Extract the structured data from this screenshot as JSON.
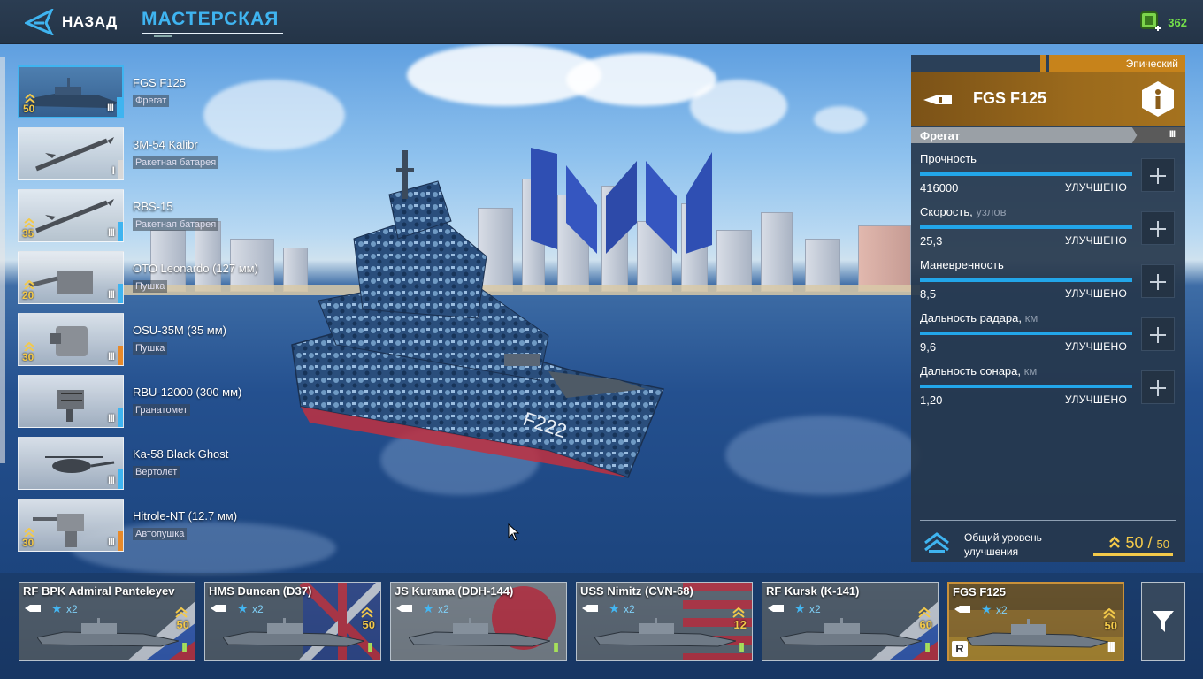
{
  "topbar": {
    "back_label": "НАЗАД",
    "tab_title": "МАСТЕРСКАЯ",
    "currency_value": "362",
    "accent_color": "#3fb4f0"
  },
  "equipment": [
    {
      "name": "FGS F125",
      "type": "Фрегат",
      "level": "50",
      "tier": "III",
      "active": true,
      "icon": "frigate-thumb-icon",
      "rank_color": "#3fb4f0"
    },
    {
      "name": "3M-54 Kalibr",
      "type": "Ракетная батарея",
      "level": "",
      "tier": "I",
      "active": false,
      "icon": "missile-icon",
      "rank_color": "#d8d8d8"
    },
    {
      "name": "RBS-15",
      "type": "Ракетная батарея",
      "level": "35",
      "tier": "III",
      "active": false,
      "icon": "missile-icon",
      "rank_color": "#3fb4f0"
    },
    {
      "name": "OTO Leonardo (127 мм)",
      "type": "Пушка",
      "level": "20",
      "tier": "III",
      "active": false,
      "icon": "cannon-icon",
      "rank_color": "#3fb4f0"
    },
    {
      "name": "OSU-35M (35 мм)",
      "type": "Пушка",
      "level": "30",
      "tier": "III",
      "active": false,
      "icon": "turret-icon",
      "rank_color": "#e88a2a"
    },
    {
      "name": "RBU-12000 (300 мм)",
      "type": "Гранатомет",
      "level": "",
      "tier": "III",
      "active": false,
      "icon": "rocket-launcher-icon",
      "rank_color": "#3fb4f0"
    },
    {
      "name": "Ka-58 Black Ghost",
      "type": "Вертолет",
      "level": "",
      "tier": "III",
      "active": false,
      "icon": "helicopter-icon",
      "rank_color": "#3fb4f0"
    },
    {
      "name": "Hitrole-NT (12.7 мм)",
      "type": "Автопушка",
      "level": "30",
      "tier": "III",
      "active": false,
      "icon": "autocannon-icon",
      "rank_color": "#e88a2a"
    }
  ],
  "panel": {
    "rarity": "Эпический",
    "ship_name": "FGS F125",
    "ship_class": "Фрегат",
    "tier": "III",
    "stats": [
      {
        "label": "Прочность",
        "unit": "",
        "value": "416000",
        "status": "УЛУЧШЕНО",
        "fill": 1.0
      },
      {
        "label": "Скорость,",
        "unit": "узлов",
        "value": "25,3",
        "status": "УЛУЧШЕНО",
        "fill": 1.0
      },
      {
        "label": "Маневренность",
        "unit": "",
        "value": "8,5",
        "status": "УЛУЧШЕНО",
        "fill": 1.0
      },
      {
        "label": "Дальность радара,",
        "unit": "км",
        "value": "9,6",
        "status": "УЛУЧШЕНО",
        "fill": 1.0
      },
      {
        "label": "Дальность сонара,",
        "unit": "км",
        "value": "1,20",
        "status": "УЛУЧШЕНО",
        "fill": 1.0
      }
    ],
    "overall_label": "Общий уровень улучшения",
    "overall_level": "50",
    "overall_separator": "/",
    "overall_max": "50"
  },
  "ships": [
    {
      "title": "RF BPK Admiral Panteleyev",
      "mult": "x2",
      "level": "50",
      "tier": "II",
      "flag": "russia",
      "active": false
    },
    {
      "title": "HMS Duncan (D37)",
      "mult": "x2",
      "level": "50",
      "tier": "II",
      "flag": "uk",
      "active": false
    },
    {
      "title": "JS Kurama (DDH-144)",
      "mult": "x2",
      "level": "",
      "tier": "II",
      "flag": "japan",
      "active": false
    },
    {
      "title": "USS Nimitz (CVN-68)",
      "mult": "x2",
      "level": "12",
      "tier": "II",
      "flag": "usa",
      "active": false
    },
    {
      "title": "RF Kursk (K-141)",
      "mult": "x2",
      "level": "60",
      "tier": "II",
      "flag": "russia",
      "active": false
    },
    {
      "title": "FGS F125",
      "mult": "x2",
      "level": "50",
      "tier": "III",
      "flag": "germany",
      "active": true,
      "badge": "R"
    }
  ]
}
